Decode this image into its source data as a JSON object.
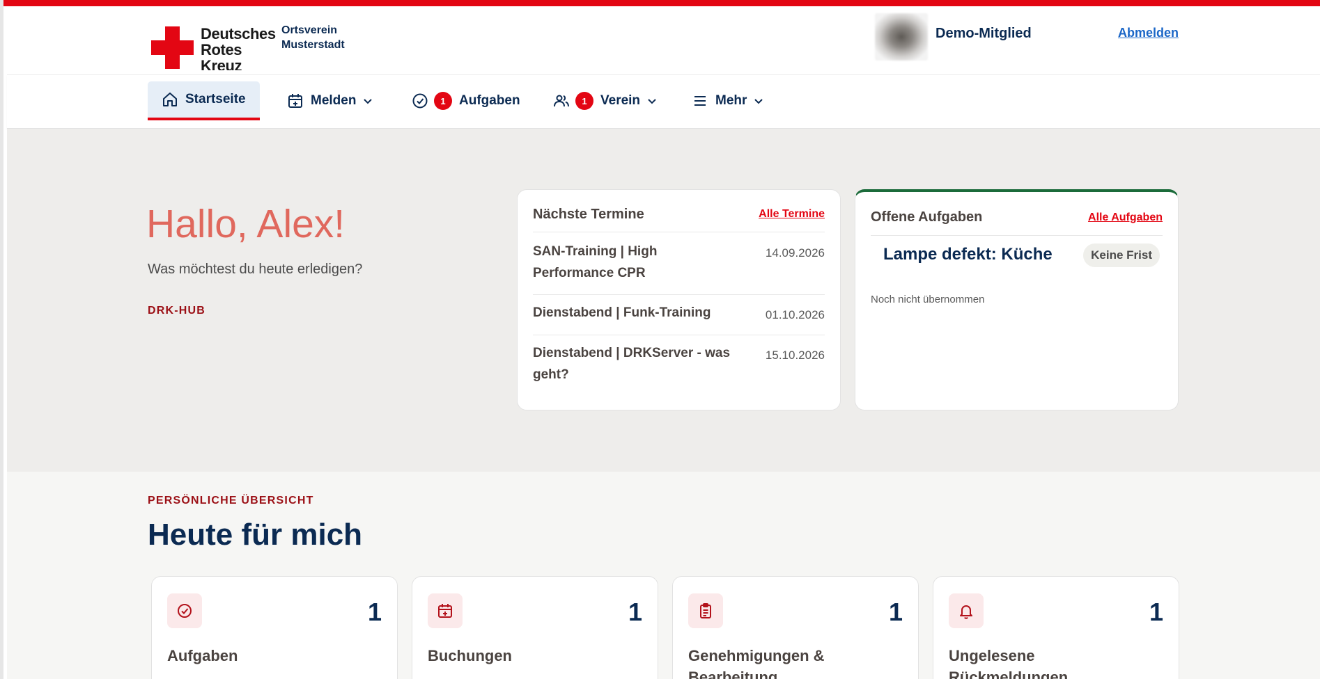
{
  "brand": {
    "logo_lines": [
      "Deutsches",
      "Rotes",
      "Kreuz"
    ],
    "org_lines": [
      "Ortsverein",
      "Musterstadt"
    ],
    "accent": "#e30613",
    "navy": "#0b2a52"
  },
  "user": {
    "name": "Demo-Mitglied",
    "logout_label": "Abmelden"
  },
  "nav": {
    "home": {
      "label": "Startseite",
      "icon": "home-icon"
    },
    "report": {
      "label": "Melden",
      "icon": "calendar-plus-icon"
    },
    "tasks": {
      "label": "Aufgaben",
      "badge": "1",
      "icon": "check-circle-icon"
    },
    "club": {
      "label": "Verein",
      "badge": "1",
      "icon": "users-icon"
    },
    "more": {
      "label": "Mehr",
      "icon": "menu-icon"
    }
  },
  "hero": {
    "eyebrow": "DRK-HUB",
    "title": "Hallo, Alex!",
    "subtitle": "Was möchtest du heute erledigen?"
  },
  "events_card": {
    "title": "Nächste Termine",
    "link": "Alle Termine",
    "items": [
      {
        "title": "SAN-Training | High Performance CPR",
        "date": "14.09.2026"
      },
      {
        "title": "Dienstabend | Funk-Training",
        "date": "01.10.2026"
      },
      {
        "title": "Dienstabend | DRKServer - was geht?",
        "date": "15.10.2026"
      }
    ]
  },
  "tasks_card": {
    "title": "Offene Aufgaben",
    "link": "Alle Aufgaben",
    "task": {
      "title": "Lampe defekt: Küche",
      "deadline": "Keine Frist",
      "status": "Noch nicht übernommen"
    }
  },
  "overview": {
    "eyebrow": "PERSÖNLICHE ÜBERSICHT",
    "title": "Heute für mich",
    "cards": [
      {
        "label": "Aufgaben",
        "count": "1",
        "icon": "check-circle-icon"
      },
      {
        "label": "Buchungen",
        "count": "1",
        "icon": "calendar-plus-icon"
      },
      {
        "label": "Genehmigungen & Bearbeitung",
        "count": "1",
        "icon": "clipboard-icon"
      },
      {
        "label": "Ungelesene Rückmeldungen",
        "count": "1",
        "icon": "bell-icon"
      }
    ]
  }
}
